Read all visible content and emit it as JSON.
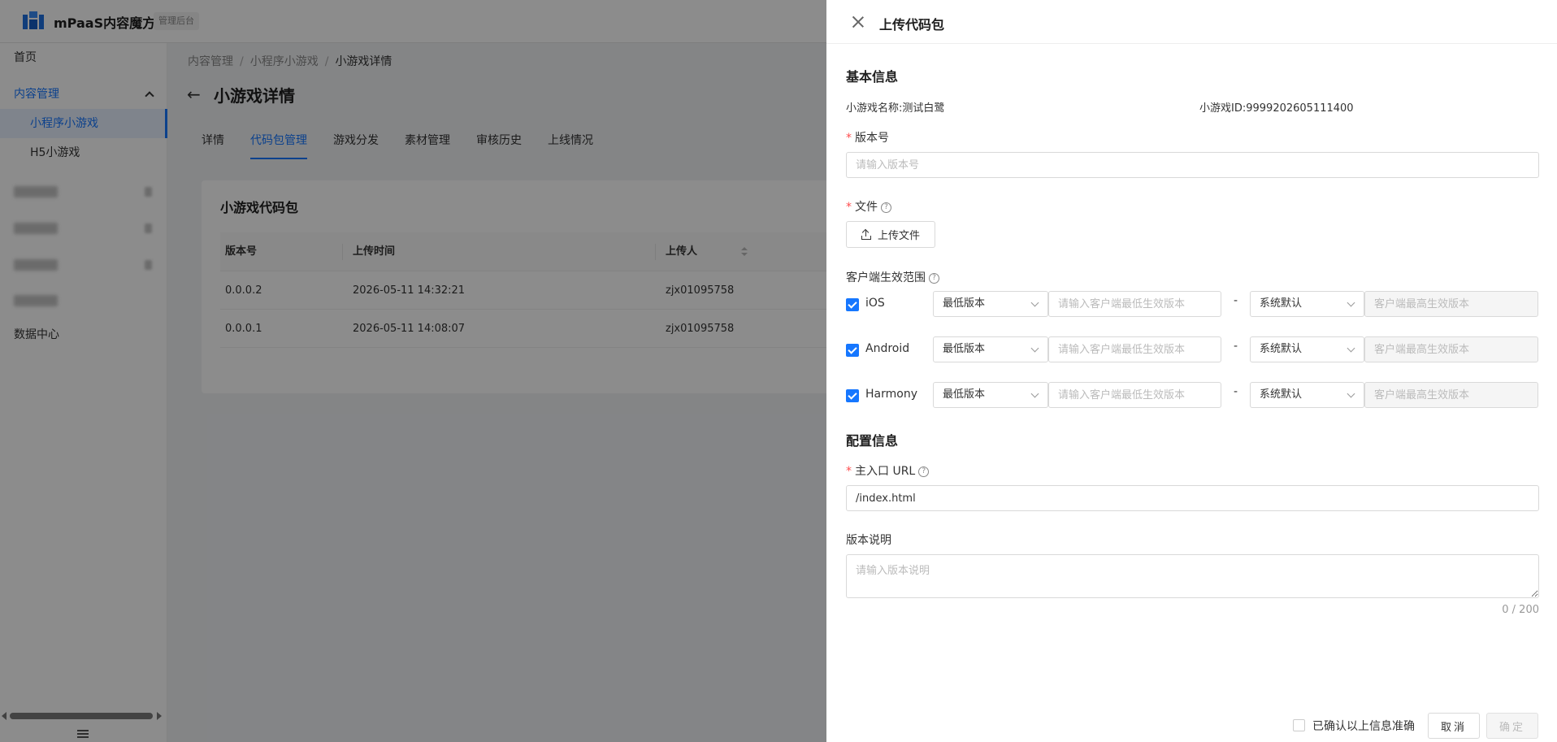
{
  "app": {
    "title": "mPaaS内容魔方",
    "tag": "管理后台"
  },
  "sidebar": {
    "home": "首页",
    "content_mgmt": "内容管理",
    "mini_game": "小程序小游戏",
    "h5_game": "H5小游戏",
    "data_center": "数据中心"
  },
  "breadcrumb": {
    "item1": "内容管理",
    "item2": "小程序小游戏",
    "item3": "小游戏详情",
    "sep": "/"
  },
  "page": {
    "back": "←",
    "title": "小游戏详情"
  },
  "tabs": [
    "详情",
    "代码包管理",
    "游戏分发",
    "素材管理",
    "审核历史",
    "上线情况"
  ],
  "card": {
    "title": "小游戏代码包",
    "columns": [
      "版本号",
      "上传时间",
      "上传人"
    ],
    "rows": [
      {
        "version": "0.0.0.2",
        "time": "2026-05-11 14:32:21",
        "uploader": "zjx01095758"
      },
      {
        "version": "0.0.0.1",
        "time": "2026-05-11 14:08:07",
        "uploader": "zjx01095758"
      }
    ]
  },
  "drawer": {
    "title": "上传代码包",
    "basic_info": "基本信息",
    "game_name_label": "小游戏名称:",
    "game_name": "测试白鹭",
    "game_id_label": "小游戏ID:",
    "game_id": "9999202605111400",
    "version_label": "版本号",
    "version_placeholder": "请输入版本号",
    "file_label": "文件",
    "upload_button": "上传文件",
    "client_range_label": "客户端生效范围",
    "platforms": [
      {
        "name": "iOS",
        "min_select": "最低版本",
        "min_placeholder": "请输入客户端最低生效版本",
        "max_select": "系统默认",
        "max_placeholder": "客户端最高生效版本"
      },
      {
        "name": "Android",
        "min_select": "最低版本",
        "min_placeholder": "请输入客户端最低生效版本",
        "max_select": "系统默认",
        "max_placeholder": "客户端最高生效版本"
      },
      {
        "name": "Harmony",
        "min_select": "最低版本",
        "min_placeholder": "请输入客户端最低生效版本",
        "max_select": "系统默认",
        "max_placeholder": "客户端最高生效版本"
      }
    ],
    "range_sep": "-",
    "config_info": "配置信息",
    "entry_url_label": "主入口 URL",
    "entry_url_value": "/index.html",
    "desc_label": "版本说明",
    "desc_placeholder": "请输入版本说明",
    "desc_counter": "0 / 200",
    "confirm_label": "已确认以上信息准确",
    "cancel_button": "取消",
    "ok_button": "确定"
  },
  "colors": {
    "primary": "#1677ff",
    "required": "#ff4d4f",
    "mask": "rgba(0,0,0,0.45)"
  }
}
